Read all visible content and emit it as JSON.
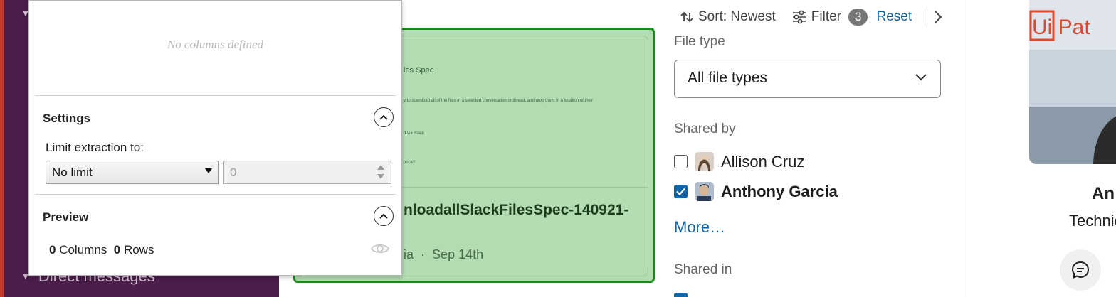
{
  "sidebar": {
    "section_label": "Direct messages"
  },
  "extraction_panel": {
    "empty_message": "No columns defined",
    "settings": {
      "title": "Settings",
      "limit_label": "Limit extraction to:",
      "limit_select_value": "No limit",
      "limit_number_value": "0"
    },
    "preview": {
      "title": "Preview",
      "columns_count": "0",
      "columns_label": "Columns",
      "rows_count": "0",
      "rows_label": "Rows"
    }
  },
  "file_card": {
    "doc_heading": "les Spec",
    "doc_line_1": "y to download all of the files in a selected conversation or thread, and drop them in a location of their",
    "doc_line_2": "d via Slack",
    "doc_line_3": "price?",
    "title": "nloadallSlackFilesSpec-140921-",
    "meta_author": "ia",
    "meta_separator": "·",
    "meta_date": "Sep 14th"
  },
  "filters": {
    "sort_label": "Sort: Newest",
    "filter_label": "Filter",
    "filter_count": "3",
    "reset_label": "Reset",
    "file_type_label": "File type",
    "file_type_value": "All file types",
    "shared_by_label": "Shared by",
    "people": [
      {
        "name": "Allison Cruz",
        "checked": false
      },
      {
        "name": "Anthony Garcia",
        "checked": true
      }
    ],
    "more_label": "More…",
    "shared_in_label": "Shared in"
  },
  "profile": {
    "logo_text": "Ui Pat",
    "name": "An",
    "role": "Technic"
  },
  "colors": {
    "sidebar_bg": "#4a1d4a",
    "card_bg": "#b3dcb3",
    "card_border": "#1a8a1a",
    "link": "#1264a3",
    "badge_bg": "#777777"
  }
}
